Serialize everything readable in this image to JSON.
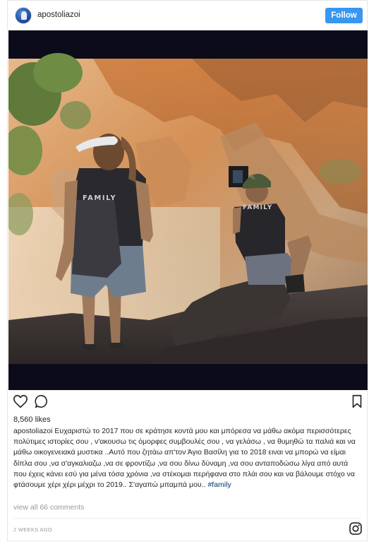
{
  "header": {
    "username": "apostoliazoi",
    "follow_label": "Follow"
  },
  "post": {
    "image_alt": "Two people in FAMILY t-shirts standing at a cave entrance facing orange cliffs",
    "shirt_text_left": "FAMILY",
    "shirt_text_right": "FAMILY"
  },
  "actions": {
    "like_icon": "heart-icon",
    "comment_icon": "comment-icon",
    "save_icon": "bookmark-icon"
  },
  "likes_text": "8,560 likes",
  "caption": {
    "username": "apostoliazoi",
    "text": " Ευχαριστώ το 2017 που σε κράτησε κοντά μου και μπόρεσα να μάθω ακόμα περισσότερες πολύτιμες ιστορίες σου , ν'ακουσω τις όμορφες συμβουλές σου , να γελάσω , να θυμηθώ τα παλιά και να μάθω οικογενειακά μυστικα ..Αυτό που ζητάω απ'τον Άγιο Βασίλη για το 2018 ειναι να μπορώ να είμαι δίπλα σου ,να σ'αγκαλιαζω ,να σε φροντίζω ,να σου δίνω δύναμη ,να σου ανταποδώσω λίγα από αυτά που έχεις κάνει εσύ για μένα τόσα χρόνια ,να στέκομαι περήφανα στο πλάι σου και να βάλουμε στόχο να φτάσουμε χέρι χέρι μέχρι το 2019.. Σ'αγαπώ μπαμπά μου.. ",
    "hashtag": "#family"
  },
  "comments_link": "view all 66 comments",
  "timestamp": "2 WEEKS AGO",
  "footer_icon": "instagram-icon",
  "colors": {
    "follow_button": "#3897f0",
    "hashtag": "#003569",
    "muted": "#999999"
  }
}
